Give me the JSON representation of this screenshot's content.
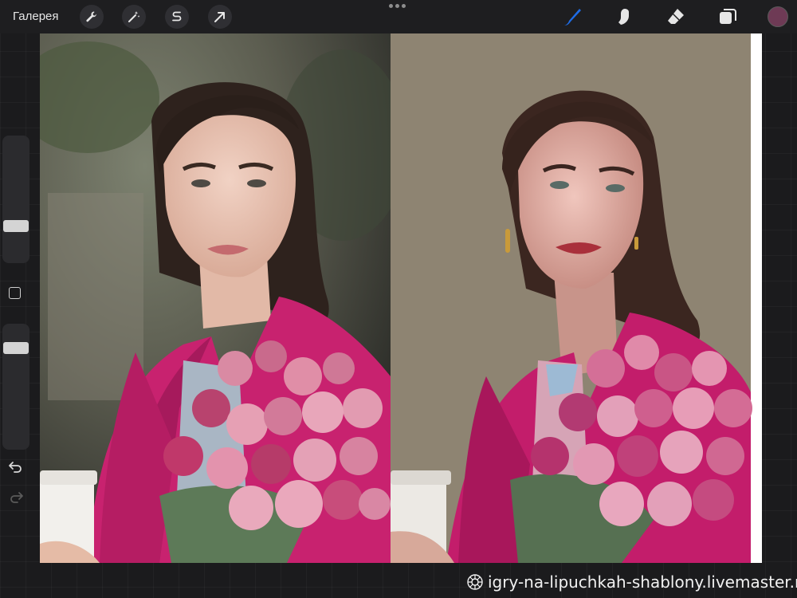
{
  "toolbar": {
    "gallery_label": "Галерея",
    "left_tools": [
      "wrench-icon",
      "magic-wand-icon",
      "selection-s-icon",
      "transform-arrow-icon"
    ],
    "right_tools": [
      "brush-icon",
      "smudge-icon",
      "eraser-icon",
      "layers-icon"
    ],
    "active_tool": "brush-icon",
    "current_color": "#6e3a55",
    "accent_color": "#1e6ce6"
  },
  "sidebar": {
    "controls": [
      "brush-size-slider",
      "modify-button",
      "opacity-slider",
      "undo-icon",
      "redo-icon"
    ]
  },
  "canvas": {
    "left_image": "reference-photo-woman-pink-coat-roses",
    "right_image": "digital-painting-woman-pink-coat-roses",
    "painting_background": "#8e8472"
  },
  "watermark": {
    "text": "igry-na-lipuchkah-shablony.livemaster.ru"
  }
}
